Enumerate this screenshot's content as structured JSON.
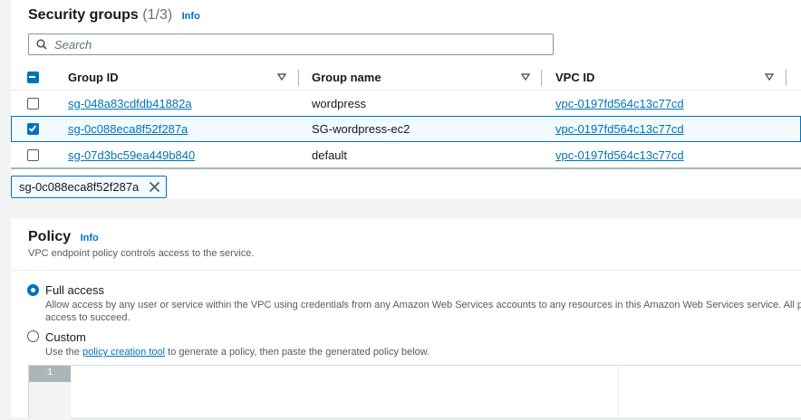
{
  "security_groups": {
    "title": "Security groups",
    "count": "(1/3)",
    "info": "Info",
    "search": {
      "placeholder": "Search"
    },
    "columns": [
      "Group ID",
      "Group name",
      "VPC ID"
    ],
    "rows": [
      {
        "group_id": "sg-048a83cdfdb41882a",
        "group_name": "wordpress",
        "vpc_id": "vpc-0197fd564c13c77cd",
        "selected": false
      },
      {
        "group_id": "sg-0c088eca8f52f287a",
        "group_name": "SG-wordpress-ec2",
        "vpc_id": "vpc-0197fd564c13c77cd",
        "selected": true
      },
      {
        "group_id": "sg-07d3bc59ea449b840",
        "group_name": "default",
        "vpc_id": "vpc-0197fd564c13c77cd",
        "selected": false
      }
    ],
    "selected_token": "sg-0c088eca8f52f287a"
  },
  "policy": {
    "title": "Policy",
    "info": "Info",
    "description": "VPC endpoint policy controls access to the service.",
    "options": [
      {
        "label": "Full access",
        "selected": true,
        "desc_line1": "Allow access by any user or service within the VPC using credentials from any Amazon Web Services accounts to any resources in this Amazon Web Services service. All polic",
        "desc_line2": "access to succeed."
      },
      {
        "label": "Custom",
        "selected": false,
        "desc_prefix": "Use the ",
        "desc_link": "policy creation tool",
        "desc_suffix": " to generate a policy, then paste the generated policy below."
      }
    ],
    "editor": {
      "line_number": "1"
    }
  },
  "colors": {
    "accent": "#0073bb",
    "selected_bg": "#f1faff",
    "border": "#aab7b8"
  }
}
